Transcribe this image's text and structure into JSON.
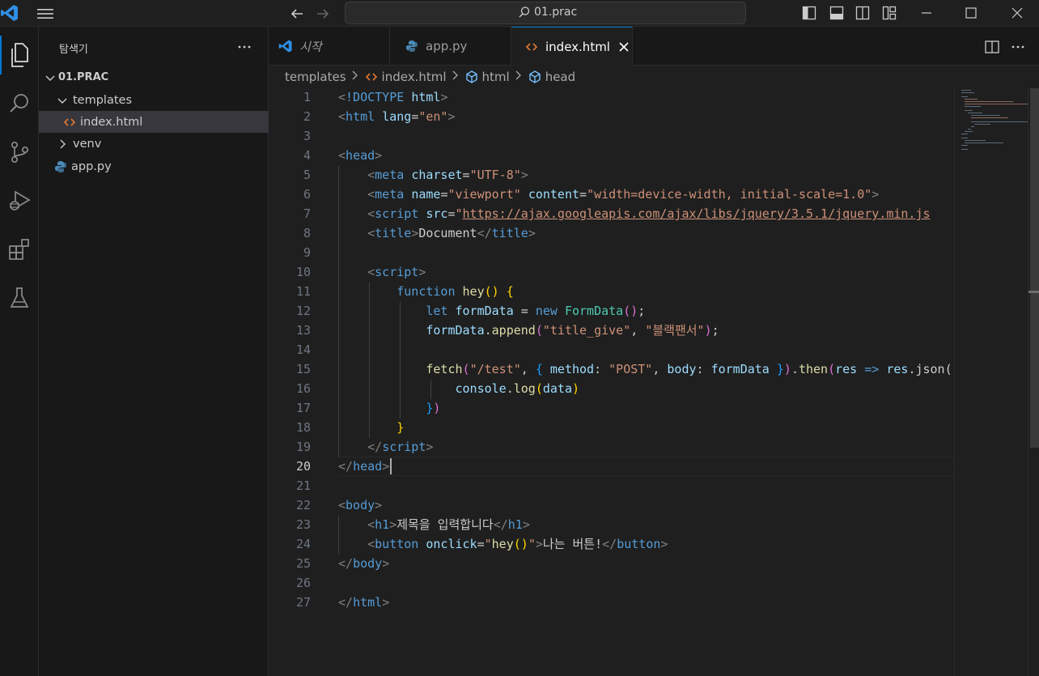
{
  "titlebar": {
    "search_text": "01.prac"
  },
  "explorer": {
    "title": "탐색기",
    "root": "01.PRAC",
    "items": [
      {
        "label": "templates",
        "kind": "folder-open"
      },
      {
        "label": "index.html",
        "kind": "html-file"
      },
      {
        "label": "venv",
        "kind": "folder-closed"
      },
      {
        "label": "app.py",
        "kind": "python-file"
      }
    ]
  },
  "tabs": [
    {
      "label": "시작",
      "icon": "vscode-logo-icon"
    },
    {
      "label": "app.py",
      "icon": "python-icon"
    },
    {
      "label": "index.html",
      "icon": "html-icon",
      "active": true
    }
  ],
  "breadcrumb": {
    "items": [
      "templates",
      "index.html",
      "html",
      "head"
    ]
  },
  "editor": {
    "current_line": 20,
    "line_numbers": [
      "1",
      "2",
      "3",
      "4",
      "5",
      "6",
      "7",
      "8",
      "9",
      "10",
      "11",
      "12",
      "13",
      "14",
      "15",
      "16",
      "17",
      "18",
      "19",
      "20",
      "21",
      "22",
      "23",
      "24",
      "25",
      "26",
      "27"
    ],
    "lines": [
      [
        [
          "t-br",
          "<"
        ],
        [
          "t-doc",
          "!DOCTYPE"
        ],
        [
          "t-txt",
          " "
        ],
        [
          "t-attr",
          "html"
        ],
        [
          "t-br",
          ">"
        ]
      ],
      [
        [
          "t-br",
          "<"
        ],
        [
          "t-tag",
          "html"
        ],
        [
          "t-txt",
          " "
        ],
        [
          "t-attr",
          "lang"
        ],
        [
          "t-txt",
          "="
        ],
        [
          "t-str",
          "\"en\""
        ],
        [
          "t-br",
          ">"
        ]
      ],
      [],
      [
        [
          "t-br",
          "<"
        ],
        [
          "t-tag",
          "head"
        ],
        [
          "t-br",
          ">"
        ]
      ],
      [
        [
          "t-txt",
          "    "
        ],
        [
          "t-br",
          "<"
        ],
        [
          "t-tag",
          "meta"
        ],
        [
          "t-txt",
          " "
        ],
        [
          "t-attr",
          "charset"
        ],
        [
          "t-txt",
          "="
        ],
        [
          "t-str",
          "\"UTF-8\""
        ],
        [
          "t-br",
          ">"
        ]
      ],
      [
        [
          "t-txt",
          "    "
        ],
        [
          "t-br",
          "<"
        ],
        [
          "t-tag",
          "meta"
        ],
        [
          "t-txt",
          " "
        ],
        [
          "t-attr",
          "name"
        ],
        [
          "t-txt",
          "="
        ],
        [
          "t-str",
          "\"viewport\""
        ],
        [
          "t-txt",
          " "
        ],
        [
          "t-attr",
          "content"
        ],
        [
          "t-txt",
          "="
        ],
        [
          "t-str",
          "\"width=device-width, initial-scale=1.0\""
        ],
        [
          "t-br",
          ">"
        ]
      ],
      [
        [
          "t-txt",
          "    "
        ],
        [
          "t-br",
          "<"
        ],
        [
          "t-tag",
          "script"
        ],
        [
          "t-txt",
          " "
        ],
        [
          "t-attr",
          "src"
        ],
        [
          "t-txt",
          "="
        ],
        [
          "t-str",
          "\""
        ],
        [
          "t-url",
          "https://ajax.googleapis.com/ajax/libs/jquery/3.5.1/jquery.min.js"
        ]
      ],
      [
        [
          "t-txt",
          "    "
        ],
        [
          "t-br",
          "<"
        ],
        [
          "t-tag",
          "title"
        ],
        [
          "t-br",
          ">"
        ],
        [
          "t-txt",
          "Document"
        ],
        [
          "t-br",
          "</"
        ],
        [
          "t-tag",
          "title"
        ],
        [
          "t-br",
          ">"
        ]
      ],
      [],
      [
        [
          "t-txt",
          "    "
        ],
        [
          "t-br",
          "<"
        ],
        [
          "t-tag",
          "script"
        ],
        [
          "t-br",
          ">"
        ]
      ],
      [
        [
          "t-txt",
          "        "
        ],
        [
          "t-kw",
          "function"
        ],
        [
          "t-txt",
          " "
        ],
        [
          "t-fn",
          "hey"
        ],
        [
          "t-p1",
          "()"
        ],
        [
          "t-txt",
          " "
        ],
        [
          "t-p1",
          "{"
        ]
      ],
      [
        [
          "t-txt",
          "            "
        ],
        [
          "t-kw",
          "let"
        ],
        [
          "t-txt",
          " "
        ],
        [
          "t-var",
          "formData"
        ],
        [
          "t-txt",
          " = "
        ],
        [
          "t-kw",
          "new"
        ],
        [
          "t-txt",
          " "
        ],
        [
          "t-cls",
          "FormData"
        ],
        [
          "t-p2",
          "()"
        ],
        [
          "t-txt",
          ";"
        ]
      ],
      [
        [
          "t-txt",
          "            "
        ],
        [
          "t-var",
          "formData"
        ],
        [
          "t-txt",
          "."
        ],
        [
          "t-fn",
          "append"
        ],
        [
          "t-p2",
          "("
        ],
        [
          "t-str",
          "\"title_give\""
        ],
        [
          "t-txt",
          ", "
        ],
        [
          "t-str",
          "\"블랙팬서\""
        ],
        [
          "t-p2",
          ")"
        ],
        [
          "t-txt",
          ";"
        ]
      ],
      [],
      [
        [
          "t-txt",
          "            "
        ],
        [
          "t-fn",
          "fetch"
        ],
        [
          "t-p2",
          "("
        ],
        [
          "t-str",
          "\"/test\""
        ],
        [
          "t-txt",
          ", "
        ],
        [
          "t-p3",
          "{"
        ],
        [
          "t-txt",
          " "
        ],
        [
          "t-var",
          "method"
        ],
        [
          "t-txt",
          ": "
        ],
        [
          "t-str",
          "\"POST\""
        ],
        [
          "t-txt",
          ", "
        ],
        [
          "t-var",
          "body"
        ],
        [
          "t-txt",
          ": "
        ],
        [
          "t-var",
          "formData"
        ],
        [
          "t-txt",
          " "
        ],
        [
          "t-p3",
          "}"
        ],
        [
          "t-p2",
          ")"
        ],
        [
          "t-txt",
          "."
        ],
        [
          "t-fn",
          "then"
        ],
        [
          "t-p2",
          "("
        ],
        [
          "t-var",
          "res"
        ],
        [
          "t-txt",
          " "
        ],
        [
          "t-kw",
          "=>"
        ],
        [
          "t-txt",
          " "
        ],
        [
          "t-var",
          "res"
        ],
        [
          "t-txt",
          ".json())"
        ]
      ],
      [
        [
          "t-txt",
          "                "
        ],
        [
          "t-var",
          "console"
        ],
        [
          "t-txt",
          "."
        ],
        [
          "t-fn",
          "log"
        ],
        [
          "t-p1",
          "("
        ],
        [
          "t-var",
          "data"
        ],
        [
          "t-p1",
          ")"
        ]
      ],
      [
        [
          "t-txt",
          "            "
        ],
        [
          "t-p3",
          "}"
        ],
        [
          "t-p2",
          ")"
        ]
      ],
      [
        [
          "t-txt",
          "        "
        ],
        [
          "t-p1",
          "}"
        ]
      ],
      [
        [
          "t-txt",
          "    "
        ],
        [
          "t-br",
          "</"
        ],
        [
          "t-tag",
          "script"
        ],
        [
          "t-br",
          ">"
        ]
      ],
      [
        [
          "t-br",
          "</"
        ],
        [
          "t-tag",
          "head"
        ],
        [
          "t-br",
          ">"
        ]
      ],
      [],
      [
        [
          "t-br",
          "<"
        ],
        [
          "t-tag",
          "body"
        ],
        [
          "t-br",
          ">"
        ]
      ],
      [
        [
          "t-txt",
          "    "
        ],
        [
          "t-br",
          "<"
        ],
        [
          "t-tag",
          "h1"
        ],
        [
          "t-br",
          ">"
        ],
        [
          "t-txt",
          "제목을 입력합니다"
        ],
        [
          "t-br",
          "</"
        ],
        [
          "t-tag",
          "h1"
        ],
        [
          "t-br",
          ">"
        ]
      ],
      [
        [
          "t-txt",
          "    "
        ],
        [
          "t-br",
          "<"
        ],
        [
          "t-tag",
          "button"
        ],
        [
          "t-txt",
          " "
        ],
        [
          "t-attr",
          "onclick"
        ],
        [
          "t-txt",
          "="
        ],
        [
          "t-str",
          "\""
        ],
        [
          "t-fn",
          "hey"
        ],
        [
          "t-p1",
          "()"
        ],
        [
          "t-str",
          "\""
        ],
        [
          "t-br",
          ">"
        ],
        [
          "t-txt",
          "나는 버튼!"
        ],
        [
          "t-br",
          "</"
        ],
        [
          "t-tag",
          "button"
        ],
        [
          "t-br",
          ">"
        ]
      ],
      [
        [
          "t-br",
          "</"
        ],
        [
          "t-tag",
          "body"
        ],
        [
          "t-br",
          ">"
        ]
      ],
      [],
      [
        [
          "t-br",
          "</"
        ],
        [
          "t-tag",
          "html"
        ],
        [
          "t-br",
          ">"
        ]
      ]
    ]
  },
  "colors": {
    "accent": "#0078d4",
    "editor_bg": "#1f1f1f",
    "sidebar_bg": "#181818"
  }
}
